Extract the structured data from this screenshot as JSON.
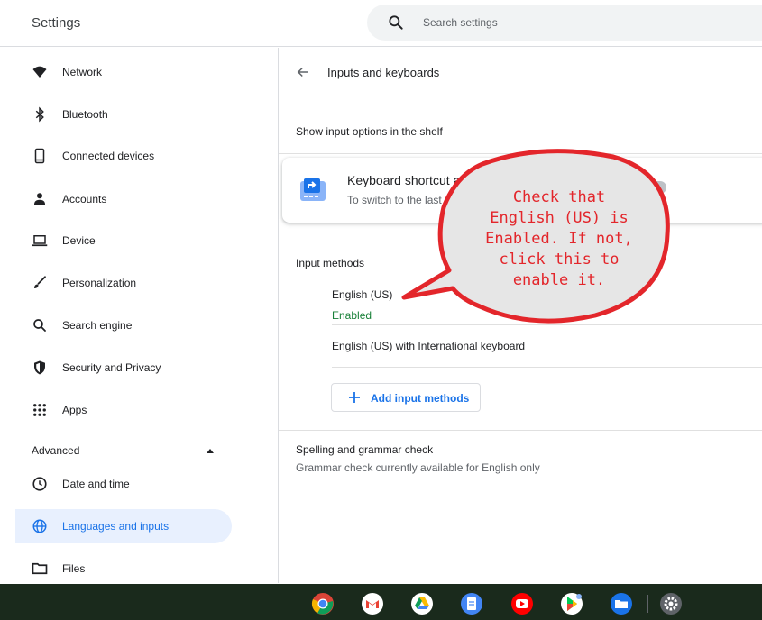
{
  "header": {
    "title": "Settings",
    "search_placeholder": "Search settings"
  },
  "sidebar": {
    "items": [
      {
        "label": "Network",
        "icon": "wifi-icon"
      },
      {
        "label": "Bluetooth",
        "icon": "bluetooth-icon"
      },
      {
        "label": "Connected devices",
        "icon": "phone-icon"
      },
      {
        "label": "Accounts",
        "icon": "person-icon"
      },
      {
        "label": "Device",
        "icon": "laptop-icon"
      },
      {
        "label": "Personalization",
        "icon": "brush-icon"
      },
      {
        "label": "Search engine",
        "icon": "search-icon"
      },
      {
        "label": "Security and Privacy",
        "icon": "shield-icon"
      },
      {
        "label": "Apps",
        "icon": "apps-grid-icon"
      }
    ],
    "advanced_label": "Advanced",
    "advanced_items": [
      {
        "label": "Date and time",
        "icon": "clock-icon"
      },
      {
        "label": "Languages and inputs",
        "icon": "globe-icon",
        "selected": true
      },
      {
        "label": "Files",
        "icon": "folder-icon"
      }
    ]
  },
  "main": {
    "page_title": "Inputs and keyboards",
    "shelf_option": "Show input options in the shelf",
    "card": {
      "title": "Keyboard shortcut a",
      "subtitle": "To switch to the last u"
    },
    "input_methods_label": "Input methods",
    "input_methods": [
      {
        "name": "English (US)",
        "status": "Enabled"
      },
      {
        "name": "English (US) with International keyboard"
      }
    ],
    "add_button_label": "Add input methods",
    "spelling": {
      "title": "Spelling and grammar check",
      "subtitle": "Grammar check currently available for English only"
    }
  },
  "annotation": {
    "lines": [
      "Check that",
      "English (US) is",
      "Enabled. If not,",
      "click this to",
      "enable it."
    ]
  },
  "shelf": {
    "apps": [
      "chrome-icon",
      "gmail-icon",
      "drive-icon",
      "docs-icon",
      "youtube-icon",
      "play-store-icon",
      "files-icon",
      "settings-icon"
    ]
  },
  "colors": {
    "accent": "#1a73e8",
    "enabled_green": "#188038",
    "selected_bg": "#e8f0fe",
    "callout_red": "#e3262b",
    "shelf_bg": "#1a2a1c"
  }
}
